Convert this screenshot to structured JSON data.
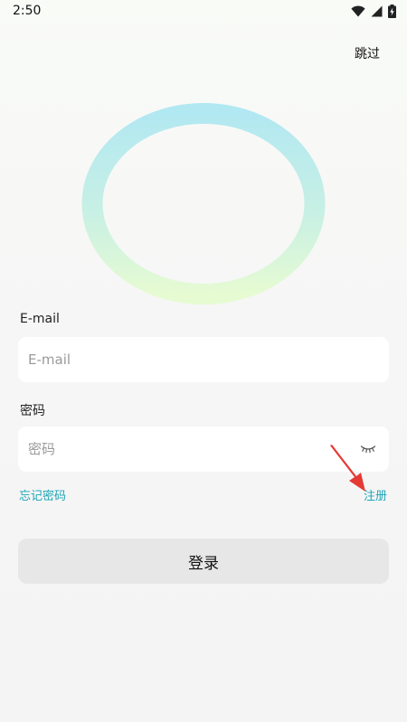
{
  "status_bar": {
    "time": "2:50",
    "icons": [
      "wifi-icon",
      "signal-icon",
      "battery-icon"
    ]
  },
  "header": {
    "skip_label": "跳过"
  },
  "form": {
    "email": {
      "label": "E-mail",
      "placeholder": "E-mail",
      "value": ""
    },
    "password": {
      "label": "密码",
      "placeholder": "密码",
      "value": "",
      "toggle_icon": "eye-closed-icon"
    },
    "forgot_label": "忘记密码",
    "register_label": "注册",
    "login_label": "登录"
  },
  "colors": {
    "accent": "#1aa6b7",
    "ring_top": "#b2e8f2",
    "ring_bottom": "#e6fbd2",
    "annotation_arrow": "#e53935",
    "button_bg": "#e7e7e7"
  }
}
